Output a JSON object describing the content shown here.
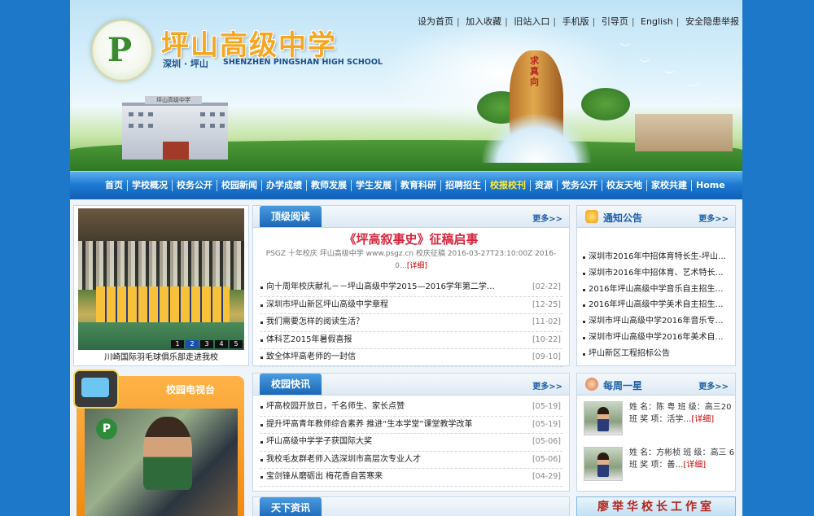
{
  "header": {
    "school_name": "坪山高级中学",
    "sub_cn": "深圳 · 坪山",
    "sub_en": "SHENZHEN PINGSHAN HIGH SCHOOL",
    "logo_letter": "P",
    "stone_text": "求真向",
    "building_sign": "坪山高级中学",
    "top_links": [
      "设为首页",
      "加入收藏",
      "旧站入口",
      "手机版",
      "引导页",
      "English",
      "安全隐患举报"
    ]
  },
  "nav": {
    "items": [
      "首页",
      "学校概况",
      "校务公开",
      "校园新闻",
      "办学成绩",
      "教师发展",
      "学生发展",
      "教育科研",
      "招聘招生",
      "校报校刊",
      "资源",
      "党务公开",
      "校友天地",
      "家校共建",
      "Home"
    ],
    "active_index": 9
  },
  "photo": {
    "caption": "川崎国际羽毛球俱乐部走进我校",
    "pages": [
      "1",
      "2",
      "3",
      "4",
      "5"
    ],
    "current_page": 2
  },
  "tv": {
    "title": "校园电视台"
  },
  "featured": {
    "tab": "顶级阅读",
    "more": "更多>>",
    "title": "《坪高叙事史》征稿启事",
    "desc": "PSGZ 十年校庆 坪山高级中学 www.psgz.cn 校庆征稿 2016-03-27T23:10:00Z 2016-0…",
    "detail": "[详细]",
    "items": [
      {
        "title": "向十周年校庆献礼－－坪山高级中学2015—2016学年第二学期…",
        "date": "[02-22]"
      },
      {
        "title": "深圳市坪山新区坪山高级中学章程",
        "date": "[12-25]"
      },
      {
        "title": "我们需要怎样的阅读生活？",
        "date": "[11-02]"
      },
      {
        "title": "体科艺2015年暑假喜报",
        "date": "[10-22]"
      },
      {
        "title": "致全体坪高老师的一封信",
        "date": "[09-10]"
      }
    ]
  },
  "news": {
    "tab": "校园快讯",
    "more": "更多>>",
    "items": [
      {
        "title": "坪高校园开放日，千名师生、家长点赞",
        "date": "[05-19]"
      },
      {
        "title": "提升坪高青年教师综合素养  推进“生本学堂”课堂教学改革",
        "date": "[05-19]"
      },
      {
        "title": "坪山高级中学学子获国际大奖",
        "date": "[05-06]"
      },
      {
        "title": "我校毛友群老师入选深圳市高层次专业人才",
        "date": "[05-06]"
      },
      {
        "title": "宝剑锋从磨砺出  梅花香自苦寒来",
        "date": "[04-29]"
      }
    ]
  },
  "world": {
    "tab": "天下资讯"
  },
  "notice": {
    "title": "通知公告",
    "more": "更多>>",
    "items": [
      "深圳市2016年中招体育特长生-坪山…",
      "深圳市2016年中招体育、艺术特长生…",
      "2016年坪山高级中学音乐自主招生成…",
      "2016年坪山高级中学美术自主招生成…",
      "深圳市坪山高级中学2016年音乐专业…",
      "深圳市坪山高级中学2016年美术自主…",
      "坪山新区工程招标公告"
    ]
  },
  "star": {
    "title": "每周一星",
    "more": "更多>>",
    "items": [
      {
        "text": "姓 名：陈 粤 班 级：高三20班 奖 项：活学…",
        "detail": "[详细]"
      },
      {
        "text": "姓 名：方彬桢 班 级：高三 6 班 奖 项：善…",
        "detail": "[详细]"
      }
    ]
  },
  "banner": {
    "text": "廖举华校长工作室"
  },
  "colors": {
    "nav_blue": "#1f7ad3",
    "title_red": "#d7263d",
    "school_orange": "#f5a623",
    "active_nav": "#ffec3a"
  }
}
